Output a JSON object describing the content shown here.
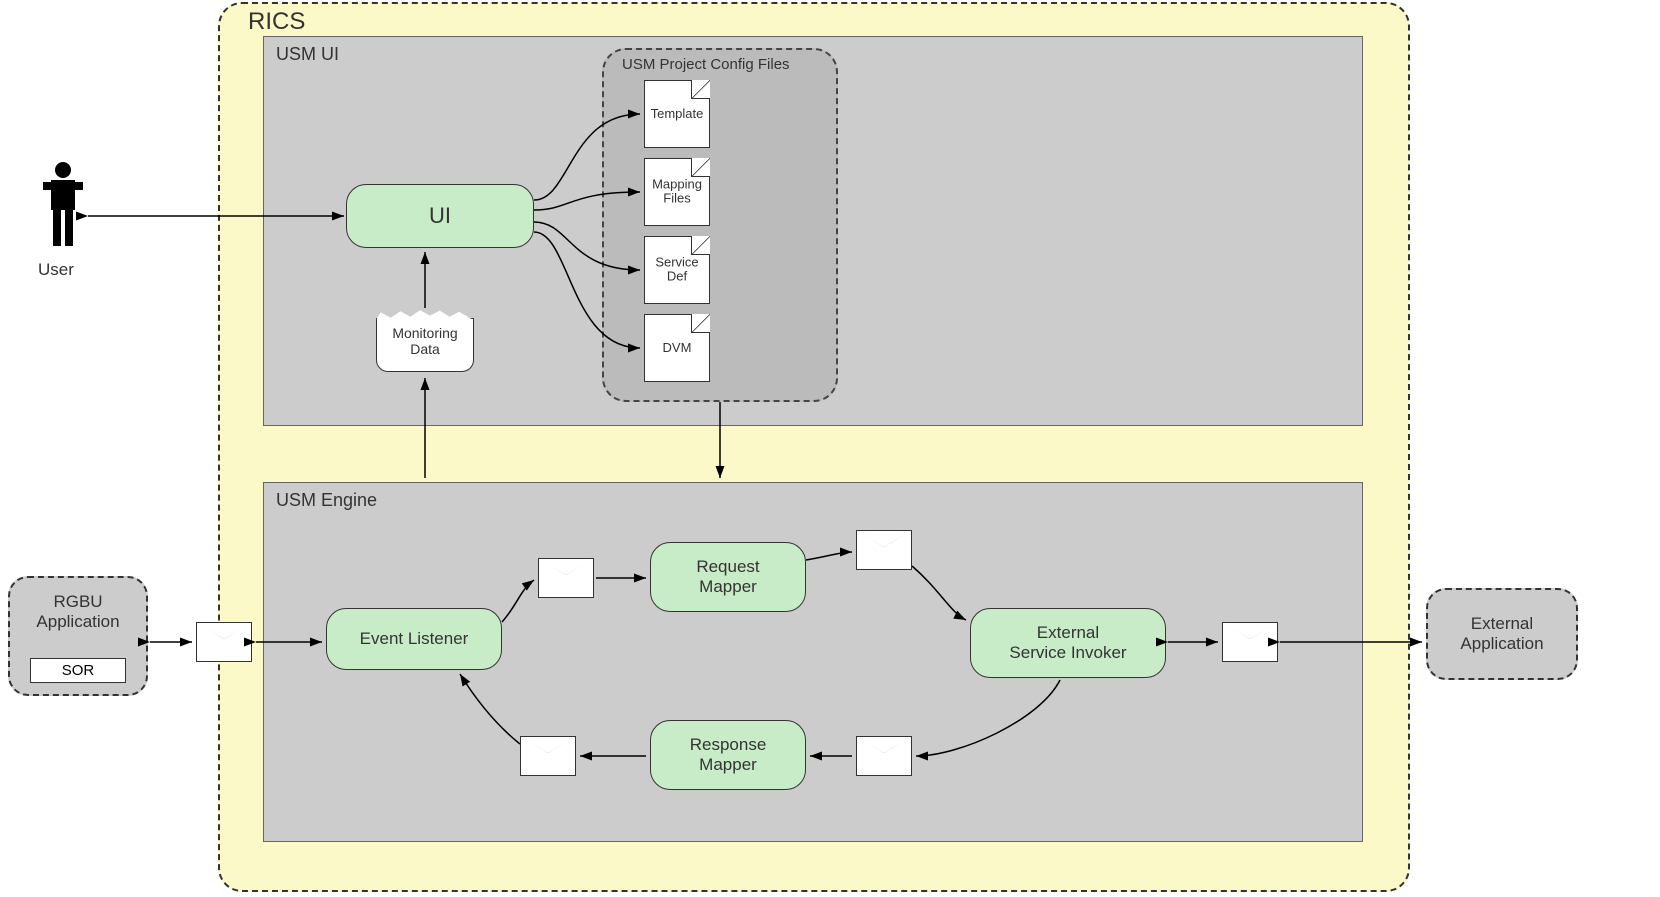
{
  "container": {
    "title": "RICS"
  },
  "usmui": {
    "title": "USM UI",
    "ui_box": "UI",
    "config_title": "USM Project Config Files"
  },
  "files": {
    "template": "Template",
    "mapping": "Mapping\nFiles",
    "service": "Service\nDef",
    "dvm": "DVM"
  },
  "monitoring": "Monitoring\nData",
  "engine": {
    "title": "USM Engine",
    "event_listener": "Event Listener",
    "request_mapper": "Request\nMapper",
    "response_mapper": "Response\nMapper",
    "invoker": "External\nService Invoker"
  },
  "user": "User",
  "rgbu": {
    "title": "RGBU\nApplication",
    "sor": "SOR"
  },
  "external": "External\nApplication"
}
